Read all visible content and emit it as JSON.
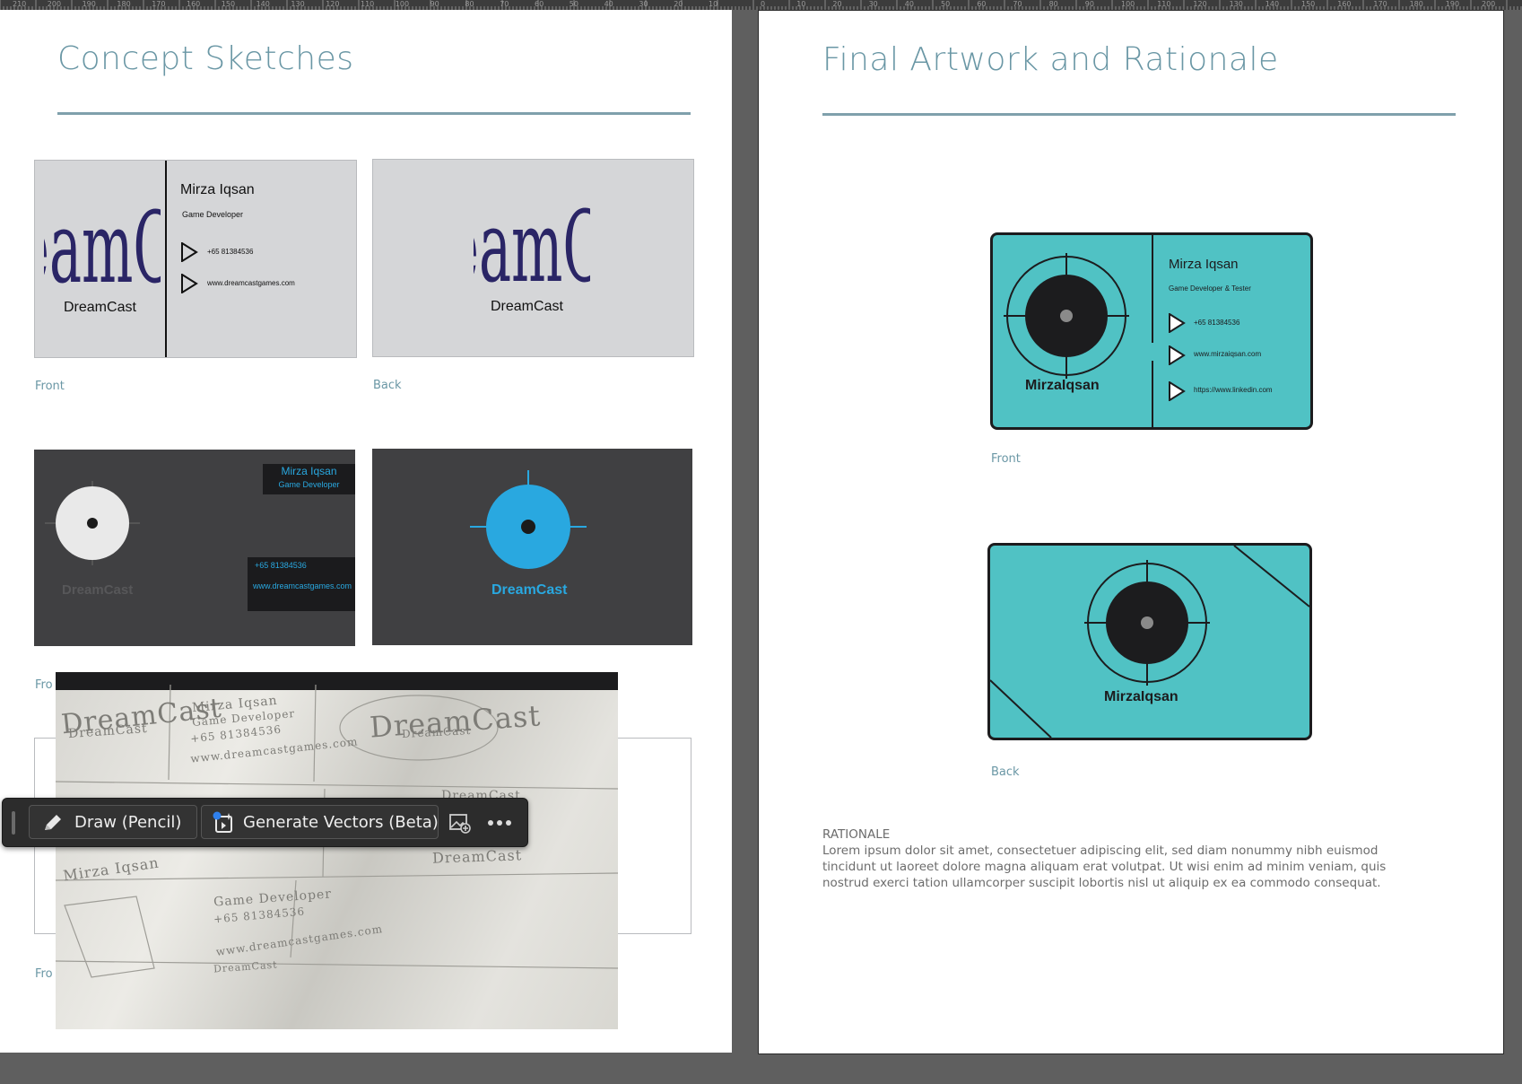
{
  "ruler": {
    "left_page_numbers": [
      "210",
      "200",
      "190",
      "180",
      "170",
      "160",
      "150",
      "140",
      "130",
      "120",
      "110",
      "100",
      "90",
      "80",
      "70",
      "60",
      "50",
      "40",
      "30",
      "20",
      "10"
    ],
    "right_page_numbers": [
      "0",
      "10",
      "20",
      "30",
      "40",
      "50",
      "60",
      "70",
      "80",
      "90",
      "100",
      "110",
      "120",
      "130",
      "140",
      "150",
      "160",
      "170",
      "180",
      "190",
      "200"
    ]
  },
  "left_page": {
    "title": "Concept Sketches",
    "captions": {
      "row1_front": "Front",
      "row1_back": "Back",
      "row2_front": "Fro",
      "row3_front": "Fro"
    },
    "light_front_card": {
      "logo": "DreamCast",
      "logo_label": "DreamCast",
      "name": "Mirza Iqsan",
      "role": "Game Developer",
      "phone": "+65 81384536",
      "website": "www.dreamcastgames.com"
    },
    "light_back_card": {
      "logo": "DreamCast",
      "logo_label": "DreamCast"
    },
    "dark_front_card": {
      "name": "Mirza Iqsan",
      "role": "Game Developer",
      "phone": "+65 81384536",
      "website": "www.dreamcastgames.com",
      "brand": "DreamCast"
    },
    "dark_back_card": {
      "brand": "DreamCast"
    },
    "sketch_photo": {
      "scribbles": [
        "DreamCast",
        "DreamCast",
        "Mirza Iqsan",
        "Game Developer",
        "+65 81384536",
        "www.dreamcastgames.com",
        "DreamCast",
        "DreamCast",
        "DreamCast",
        "DreamCast",
        "Mirza Iqsan",
        "Game Developer",
        "+65 81384536",
        "www.dreamcastgames.com",
        "DreamCast"
      ]
    }
  },
  "toolbar": {
    "draw_label": "Draw (Pencil)",
    "generate_label": "Generate Vectors (Beta)",
    "icons": [
      "pencil-icon",
      "generate-vectors-icon",
      "image-add-icon",
      "more-icon"
    ]
  },
  "right_page": {
    "title": "Final Artwork and Rationale",
    "front_caption": "Front",
    "back_caption": "Back",
    "front_card": {
      "brand": "MirzaIqsan",
      "name": "Mirza Iqsan",
      "role": "Game Developer & Tester",
      "phone": "+65 81384536",
      "website": "www.mirzaiqsan.com",
      "linkedin": "https://www.linkedin.com"
    },
    "back_card": {
      "brand": "MirzaIqsan"
    },
    "rationale_heading": "RATIONALE",
    "rationale_body": "Lorem ipsum dolor sit amet, consectetuer adipiscing elit, sed diam nonummy nibh euismod tincidunt ut laoreet dolore magna aliquam erat volutpat. Ut wisi enim ad minim veniam, quis nostrud exerci tation ullamcorper suscipit lobortis nisl ut aliquip ex ea commodo consequat."
  },
  "colors": {
    "title_teal": "#6a97a5",
    "card_teal": "#50c2c4",
    "card_dark": "#404042",
    "accent_blue": "#29a8e0",
    "logo_navy": "#2a2566"
  }
}
